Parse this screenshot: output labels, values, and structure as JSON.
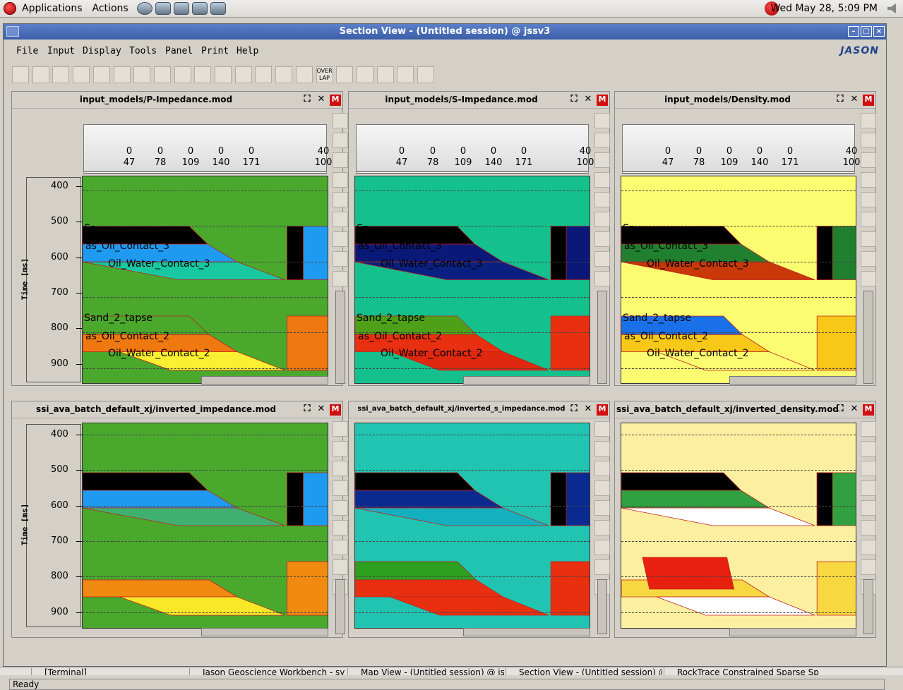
{
  "desktop": {
    "menus": [
      "Applications",
      "Actions"
    ],
    "clock": "Wed May 28,  5:09 PM"
  },
  "window": {
    "title": "Section View - (Untitled session) @ jssv3",
    "menu": [
      "File",
      "Input",
      "Display",
      "Tools",
      "Panel",
      "Print",
      "Help"
    ],
    "brand": "JASON",
    "toolbar": [
      "new",
      "open",
      "save",
      "wiggle",
      "horizon",
      "well",
      "color-bar",
      "layers",
      "traces",
      "spectrum",
      "overlay-list",
      "scale",
      "crosshair",
      "log",
      "palette",
      "OVER LAP",
      "pin",
      "zoom",
      "zoom-reset",
      "print",
      "camera"
    ]
  },
  "panels": [
    {
      "title": "input_models/P-Impedance.mod",
      "bg": "#4aa82c",
      "horizons": [
        "Sa",
        "as_Oil_Contact_3",
        "Oil_Water_Contact_3",
        "Sand_2_tapse",
        "as_Oil_Contact_2",
        "Oil_Water_Contact_2"
      ],
      "c": [
        "#000000",
        "#1e9bf0",
        "#18c8a0",
        "#4aa82c",
        "#f07810",
        "#f8f030"
      ]
    },
    {
      "title": "input_models/S-Impedance.mod",
      "bg": "#14c08c",
      "horizons": [
        "Sa",
        "as_Oil_Contact_3",
        "Oil_Water_Contact_3",
        "Sand_2_tapse",
        "as_Oil_Contact_2",
        "Oil_Water_Contact_2"
      ],
      "c": [
        "#000000",
        "#0a1878",
        "#0a2080",
        "#4ea018",
        "#e83010",
        "#e02810"
      ]
    },
    {
      "title": "input_models/Density.mod",
      "bg": "#fcfc70",
      "horizons": [
        "Sa",
        "as_Oil_Contact_3",
        "Oil_Water_Contact_3",
        "Sand_2_tapse",
        "as_Oil_Contact_2",
        "Oil_Water_Contact_2"
      ],
      "c": [
        "#000000",
        "#208030",
        "#c83808",
        "#1a70e8",
        "#f8c818",
        "#fcfc70"
      ]
    },
    {
      "title": "ssi_ava_batch_default_xj/inverted_impedance.mod",
      "bg": "#4aa82c",
      "horizons": [],
      "c": [
        "#000000",
        "#1e9bf0",
        "#40b070",
        "#4aa82c",
        "#f08a10",
        "#f8e828"
      ]
    },
    {
      "title": "ssi_ava_batch_default_xj/inverted_s_impedance.mod",
      "bg": "#20c4b0",
      "horizons": [],
      "c": [
        "#000000",
        "#0a2a90",
        "#14b0c0",
        "#2ea020",
        "#e83010",
        "#e83010"
      ]
    },
    {
      "title": "ssi_ava_batch_default_xj/inverted_density.mod",
      "bg": "#fcf0a0",
      "horizons": [],
      "c": [
        "#000000",
        "#30a040",
        "#ffffff",
        "#e82010",
        "#f8d840",
        "#ffffff"
      ]
    }
  ],
  "trace_header": {
    "row1": [
      "0",
      "0",
      "0",
      "0",
      "0",
      "40"
    ],
    "row2": [
      "47",
      "78",
      "109",
      "140",
      "171",
      "100"
    ]
  },
  "time_axis": {
    "label": "Time [ms]",
    "ticks": [
      "400",
      "500",
      "600",
      "700",
      "800",
      "900"
    ]
  },
  "status": "Ready",
  "taskbar": [
    "[Terminal]",
    "Jason Geoscience Workbench - sy",
    "Map View - (Untitled session) @ js",
    "Section View - (Untitled session) @",
    "RockTrace Constrained Sparse Sp"
  ]
}
